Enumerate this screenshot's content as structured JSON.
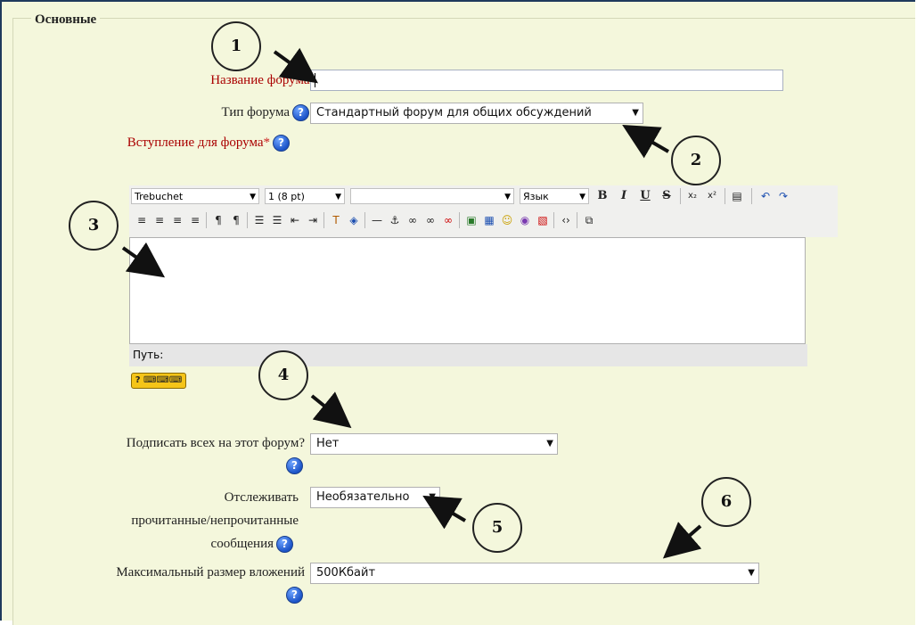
{
  "section_legend": "Основные",
  "fields": {
    "forum_name": {
      "label": "Название форума",
      "required_mark": "*",
      "value": ""
    },
    "forum_type": {
      "label": "Тип форума",
      "selected": "Стандартный форум для общих обсуждений"
    },
    "intro": {
      "label": "Вступление для форума",
      "required_mark": "*"
    },
    "subscribe": {
      "label": "Подписать всех на этот форум?",
      "selected": "Нет"
    },
    "tracking": {
      "label_line1": "Отслеживать",
      "label_line2": "прочитанные/непрочитанные",
      "label_line3": "сообщения",
      "selected": "Необязательно"
    },
    "max_attach": {
      "label": "Максимальный размер вложений",
      "selected": "500Кбайт"
    }
  },
  "editor": {
    "font_family": "Trebuchet",
    "font_size": "1 (8 pt)",
    "style": "",
    "language": "Язык",
    "path_label": "Путь:",
    "keyboard_badge": "? ⌨⌨⌨"
  },
  "callouts": [
    "1",
    "2",
    "3",
    "4",
    "5",
    "6"
  ],
  "help_glyph": "?",
  "colors": {
    "background": "#f4f7dc",
    "required": "#aa0000",
    "help": "#1c54c8"
  }
}
